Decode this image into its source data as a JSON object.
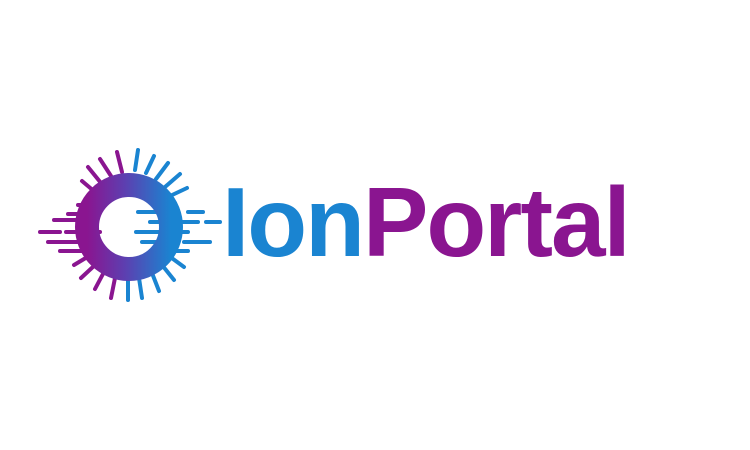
{
  "brand": {
    "name_part_1": "Ion",
    "name_part_2": "Portal",
    "logo_icon": "ion-ring-icon"
  },
  "colors": {
    "background": "#ffffff",
    "blue": "#1a84d1",
    "purple": "#8a1590"
  }
}
